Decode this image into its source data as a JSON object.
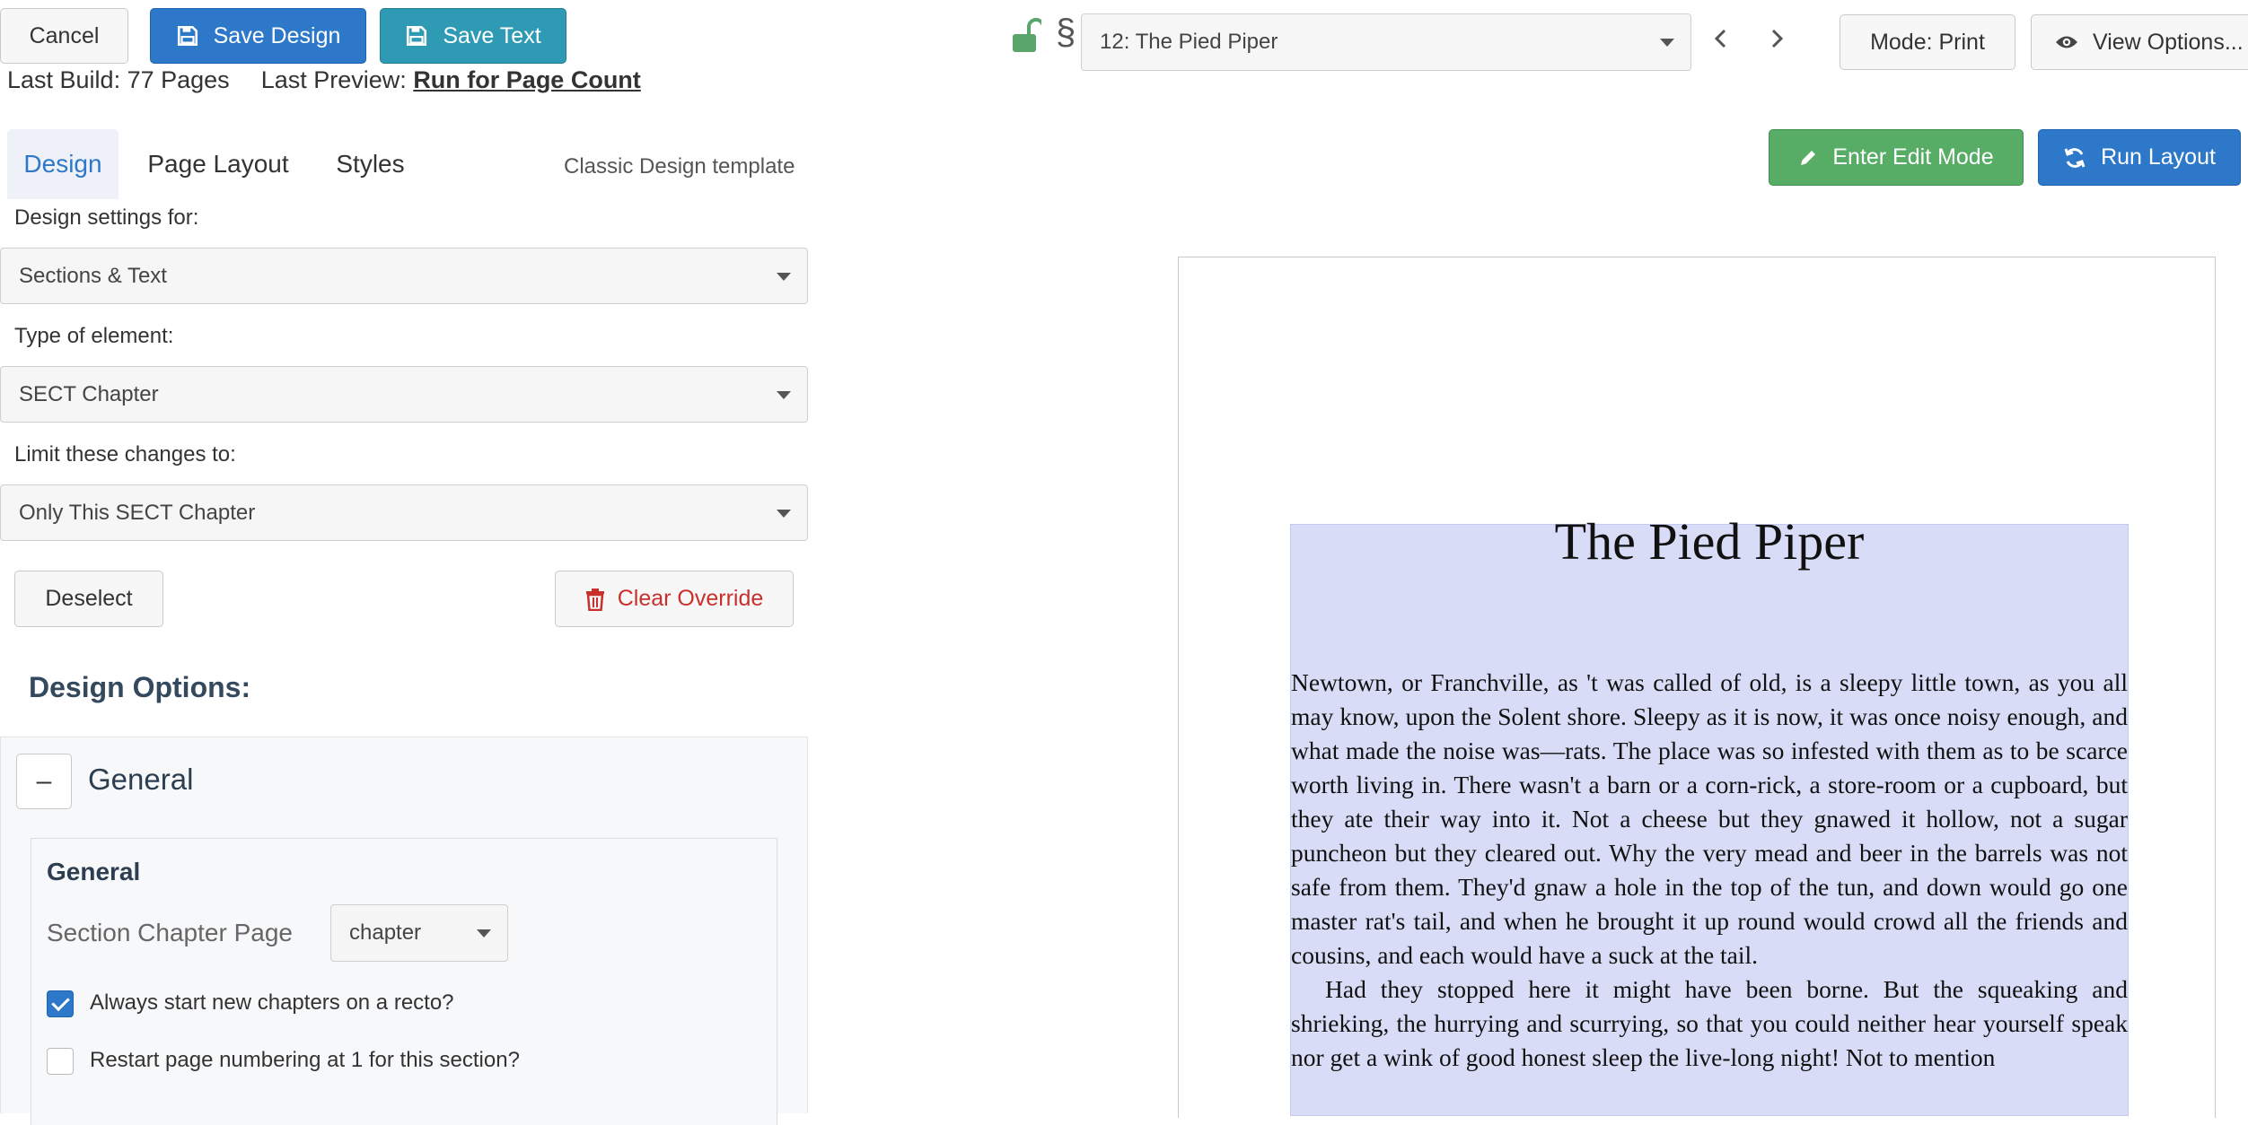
{
  "toolbar": {
    "cancel_label": "Cancel",
    "save_design_label": "Save Design",
    "save_text_label": "Save Text",
    "last_build_label": "Last Build:",
    "last_build_value": "77 Pages",
    "last_preview_label": "Last Preview:",
    "last_preview_link": "Run for Page Count"
  },
  "nav": {
    "section_symbol": "§",
    "chapter_select": "12: The Pied Piper",
    "mode_label": "Mode: Print",
    "view_options_label": "View Options..."
  },
  "actions": {
    "enter_edit_label": "Enter Edit Mode",
    "run_layout_label": "Run Layout"
  },
  "tabs": [
    {
      "label": "Design",
      "active": true
    },
    {
      "label": "Page Layout",
      "active": false
    },
    {
      "label": "Styles",
      "active": false
    }
  ],
  "template_label": "Classic Design template",
  "settings": {
    "design_for_label": "Design settings for:",
    "design_for_value": "Sections & Text",
    "element_type_label": "Type of element:",
    "element_type_value": "SECT Chapter",
    "limit_label": "Limit these changes to:",
    "limit_value": "Only This SECT Chapter",
    "deselect_label": "Deselect",
    "clear_override_label": "Clear Override"
  },
  "design_options": {
    "heading": "Design Options:",
    "group_toggle": "–",
    "group_title": "General",
    "card_title": "General",
    "section_page_label": "Section Chapter Page",
    "section_page_value": "chapter",
    "checkbox1_label": "Always start new chapters on a recto?",
    "checkbox1_checked": true,
    "checkbox2_label": "Restart page numbering at 1 for this section?",
    "checkbox2_checked": false
  },
  "preview": {
    "chapter_title": "The Pied Piper",
    "paragraph1": "Newtown, or Franchville, as 't was called of old, is a sleepy little town, as you all may know, upon the Solent shore. Sleepy as it is now, it was once noisy enough, and what made the noise was—rats. The place was so infested with them as to be scarce worth living in. There wasn't a barn or a corn-rick, a store-room or a cupboard, but they ate their way into it. Not a cheese but they gnawed it hollow, not a sugar puncheon but they cleared out. Why the very mead and beer in the barrels was not safe from them. They'd gnaw a hole in the top of the tun, and down would go one master rat's tail, and when he brought it up round would crowd all the friends and cousins, and each would have a suck at the tail.",
    "paragraph2": "Had they stopped here it might have been borne. But the squeaking and shrieking, the hurrying and scurrying, so that you could neither hear yourself speak nor get a wink of good honest sleep the live-long night! Not to mention"
  },
  "colors": {
    "primary": "#2d78c9",
    "teal": "#2f9ab3",
    "success": "#57ad65",
    "danger": "#c9302c",
    "selection": "#d8dcf6",
    "lock": "#5aa66a"
  }
}
